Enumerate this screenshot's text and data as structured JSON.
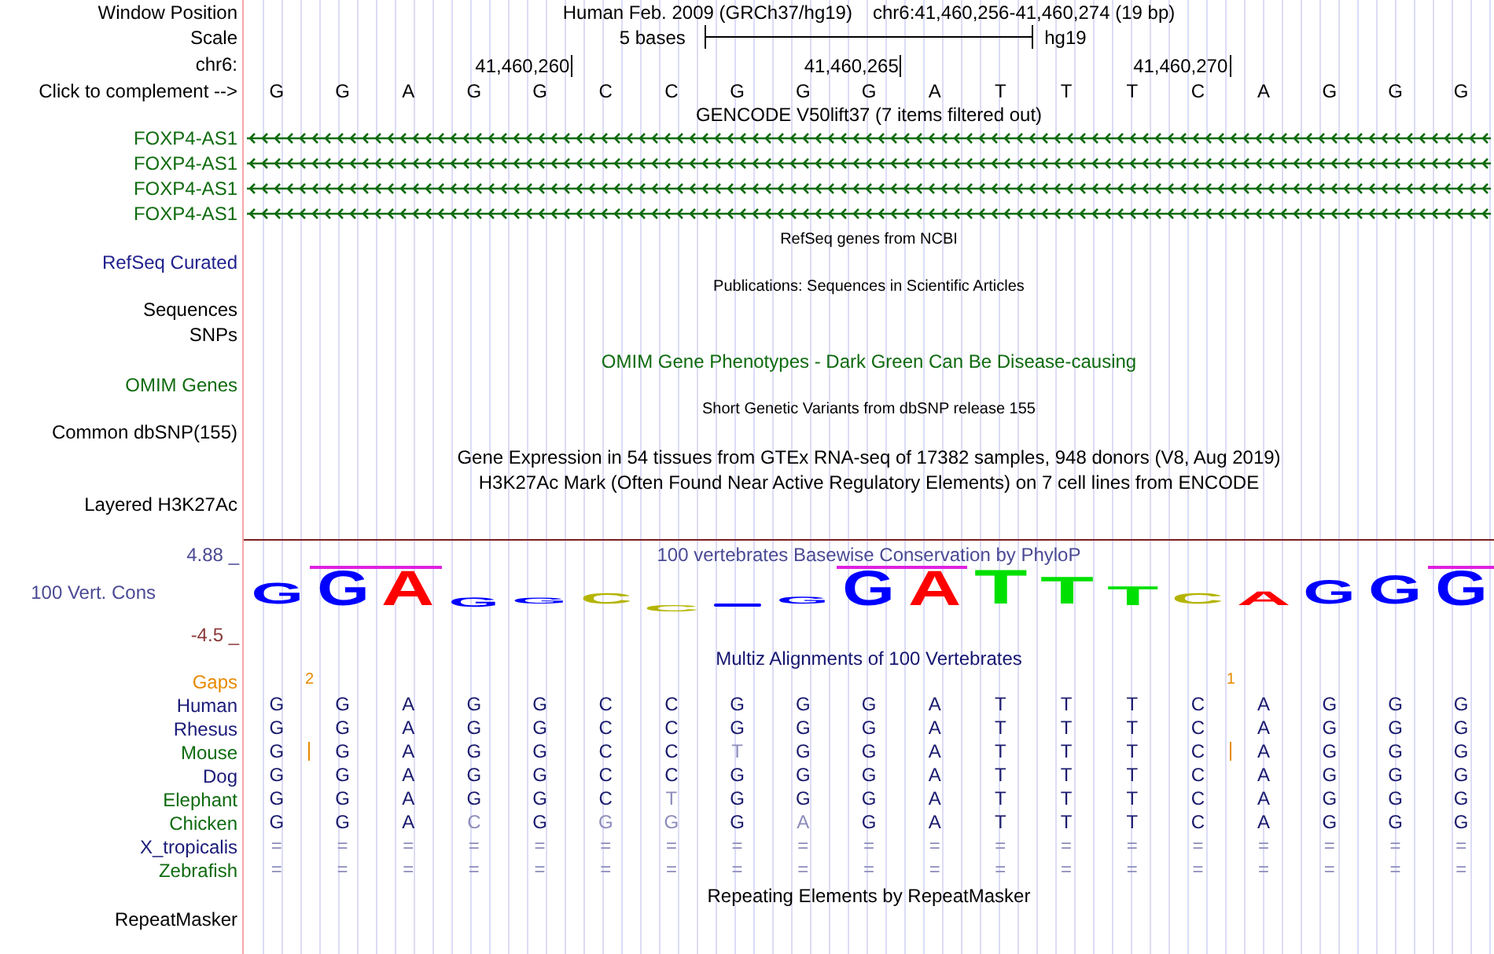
{
  "header": {
    "window_position": {
      "label": "Window Position",
      "assembly": "Human Feb. 2009 (GRCh37/hg19)",
      "range": "chr6:41,460,256-41,460,274 (19 bp)"
    },
    "scale": {
      "label": "Scale",
      "span": "5 bases",
      "assembly": "hg19"
    },
    "ruler": {
      "label": "chr6:",
      "ticks": [
        "41,460,260",
        "41,460,265",
        "41,460,270"
      ]
    },
    "sequence": {
      "label": "Click to complement -->",
      "bases": [
        "G",
        "G",
        "A",
        "G",
        "G",
        "C",
        "C",
        "G",
        "G",
        "G",
        "A",
        "T",
        "T",
        "T",
        "C",
        "A",
        "G",
        "G",
        "G"
      ]
    }
  },
  "tracks": [
    {
      "kind": "genes",
      "title": {
        "text": "GENCODE V50lift37 (7 items filtered out)",
        "color": "#000000"
      },
      "items": [
        {
          "label": "FOXP4-AS1",
          "color": "#0f6b0f"
        },
        {
          "label": "FOXP4-AS1",
          "color": "#0f6b0f"
        },
        {
          "label": "FOXP4-AS1",
          "color": "#0f6b0f"
        },
        {
          "label": "FOXP4-AS1",
          "color": "#0f6b0f"
        }
      ]
    },
    {
      "kind": "compact",
      "title": {
        "text": "RefSeq genes from NCBI",
        "color": "#000000"
      },
      "label": {
        "text": "RefSeq Curated",
        "color": "#1e1e8c"
      }
    },
    {
      "kind": "compact",
      "title": {
        "text": "Publications: Sequences in Scientific Articles",
        "color": "#000000"
      },
      "label": {
        "text": "Sequences",
        "color": "#000000"
      }
    },
    {
      "kind": "compact",
      "label": {
        "text": "SNPs",
        "color": "#000000"
      }
    },
    {
      "kind": "full",
      "title": {
        "text": "OMIM Gene Phenotypes - Dark Green Can Be Disease-causing",
        "color": "#0f6b0f"
      },
      "label": {
        "text": "OMIM Genes",
        "color": "#0f6b0f"
      }
    },
    {
      "kind": "compact",
      "title": {
        "text": "Short Genetic Variants from dbSNP release 155",
        "color": "#000000"
      },
      "label": {
        "text": "Common dbSNP(155)",
        "color": "#000000"
      }
    },
    {
      "kind": "full",
      "title": {
        "text": "Gene Expression in 54 tissues from GTEx RNA-seq of 17382 samples, 948 donors (V8, Aug 2019)",
        "color": "#000000"
      }
    },
    {
      "kind": "signal",
      "title": {
        "text": "H3K27Ac Mark (Often Found Near Active Regulatory Elements) on 7 cell lines from ENCODE",
        "color": "#000000"
      },
      "label": {
        "text": "Layered H3K27Ac",
        "color": "#000000"
      }
    },
    {
      "kind": "conservation",
      "title": {
        "text": "100 vertebrates Basewise Conservation by PhyloP",
        "color": "#4a4a94"
      },
      "label": {
        "text": "100 Vert. Cons",
        "color": "#4a4a94"
      },
      "axis_labels": [
        {
          "text": "4.88 _",
          "color": "#4a4a94"
        },
        {
          "text": "-4.5 _",
          "color": "#8b3a3a"
        }
      ],
      "logo": [
        {
          "base": "G",
          "color": "#0000ff",
          "clipped": false
        },
        {
          "base": "G",
          "color": "#0000ff",
          "clipped": true
        },
        {
          "base": "A",
          "color": "#ff0000",
          "clipped": true
        },
        {
          "base": "G",
          "color": "#0000ff",
          "clipped": false
        },
        {
          "base": "G",
          "color": "#0000ff",
          "clipped": false
        },
        {
          "base": "C",
          "color": "#b4b400",
          "clipped": false
        },
        {
          "base": "C",
          "color": "#b4b400",
          "clipped": false
        },
        {
          "color": "#0000ff",
          "clipped": false
        },
        {
          "base": "G",
          "color": "#0000ff",
          "clipped": false
        },
        {
          "base": "G",
          "color": "#0000ff",
          "clipped": true
        },
        {
          "base": "A",
          "color": "#ff0000",
          "clipped": true
        },
        {
          "base": "T",
          "color": "#00e000",
          "clipped": false
        },
        {
          "base": "T",
          "color": "#00e000",
          "clipped": false
        },
        {
          "base": "T",
          "color": "#00e000",
          "clipped": false
        },
        {
          "base": "C",
          "color": "#b4b400",
          "clipped": false
        },
        {
          "base": "A",
          "color": "#ff0000",
          "clipped": false
        },
        {
          "base": "G",
          "color": "#0000ff",
          "clipped": false
        },
        {
          "base": "G",
          "color": "#0000ff",
          "clipped": false
        },
        {
          "base": "G",
          "color": "#0000ff",
          "clipped": true
        }
      ]
    },
    {
      "kind": "alignment",
      "title": {
        "text": "Multiz Alignments of 100 Vertebrates",
        "color": "#141470"
      },
      "gaps": {
        "label": "Gaps",
        "columns": [
          {
            "insertion": false
          },
          {
            "insertion": true,
            "count": "2"
          },
          {
            "insertion": false
          },
          {
            "insertion": false
          },
          {
            "insertion": false
          },
          {
            "insertion": false
          },
          {
            "insertion": false
          },
          {
            "insertion": false
          },
          {
            "insertion": false
          },
          {
            "insertion": false
          },
          {
            "insertion": false
          },
          {
            "insertion": false
          },
          {
            "insertion": false
          },
          {
            "insertion": false
          },
          {
            "insertion": false
          },
          {
            "insertion": true,
            "count": "1"
          },
          {
            "insertion": false
          },
          {
            "insertion": false
          },
          {
            "insertion": false
          }
        ]
      },
      "species": [
        {
          "name": "Human",
          "color": "#1a1a78",
          "bases": [
            {
              "base": "G",
              "match": true
            },
            {
              "base": "G",
              "match": true
            },
            {
              "base": "A",
              "match": true
            },
            {
              "base": "G",
              "match": true
            },
            {
              "base": "G",
              "match": true
            },
            {
              "base": "C",
              "match": true
            },
            {
              "base": "C",
              "match": true
            },
            {
              "base": "G",
              "match": true
            },
            {
              "base": "G",
              "match": true
            },
            {
              "base": "G",
              "match": true
            },
            {
              "base": "A",
              "match": true
            },
            {
              "base": "T",
              "match": true
            },
            {
              "base": "T",
              "match": true
            },
            {
              "base": "T",
              "match": true
            },
            {
              "base": "C",
              "match": true
            },
            {
              "base": "A",
              "match": true
            },
            {
              "base": "G",
              "match": true
            },
            {
              "base": "G",
              "match": true
            },
            {
              "base": "G",
              "match": true
            }
          ]
        },
        {
          "name": "Rhesus",
          "color": "#1a1a78",
          "bases": [
            {
              "base": "G",
              "match": true
            },
            {
              "base": "G",
              "match": true
            },
            {
              "base": "A",
              "match": true
            },
            {
              "base": "G",
              "match": true
            },
            {
              "base": "G",
              "match": true
            },
            {
              "base": "C",
              "match": true
            },
            {
              "base": "C",
              "match": true
            },
            {
              "base": "G",
              "match": true
            },
            {
              "base": "G",
              "match": true
            },
            {
              "base": "G",
              "match": true
            },
            {
              "base": "A",
              "match": true
            },
            {
              "base": "T",
              "match": true
            },
            {
              "base": "T",
              "match": true
            },
            {
              "base": "T",
              "match": true
            },
            {
              "base": "C",
              "match": true
            },
            {
              "base": "A",
              "match": true
            },
            {
              "base": "G",
              "match": true
            },
            {
              "base": "G",
              "match": true
            },
            {
              "base": "G",
              "match": true
            }
          ]
        },
        {
          "name": "Mouse",
          "color": "#0f6b0f",
          "bases": [
            {
              "base": "G",
              "match": true,
              "insertion": false
            },
            {
              "base": "G",
              "match": true,
              "insertion": true
            },
            {
              "base": "A",
              "match": true,
              "insertion": false
            },
            {
              "base": "G",
              "match": true,
              "insertion": false
            },
            {
              "base": "G",
              "match": true,
              "insertion": false
            },
            {
              "base": "C",
              "match": true,
              "insertion": false
            },
            {
              "base": "C",
              "match": true,
              "insertion": false
            },
            {
              "base": "T",
              "match": false,
              "insertion": false
            },
            {
              "base": "G",
              "match": true,
              "insertion": false
            },
            {
              "base": "G",
              "match": true,
              "insertion": false
            },
            {
              "base": "A",
              "match": true,
              "insertion": false
            },
            {
              "base": "T",
              "match": true,
              "insertion": false
            },
            {
              "base": "T",
              "match": true,
              "insertion": false
            },
            {
              "base": "T",
              "match": true,
              "insertion": false
            },
            {
              "base": "C",
              "match": true,
              "insertion": false
            },
            {
              "base": "A",
              "match": true,
              "insertion": true
            },
            {
              "base": "G",
              "match": true,
              "insertion": false
            },
            {
              "base": "G",
              "match": true,
              "insertion": false
            },
            {
              "base": "G",
              "match": true,
              "insertion": false
            }
          ]
        },
        {
          "name": "Dog",
          "color": "#1a1a78",
          "bases": [
            {
              "base": "G",
              "match": true
            },
            {
              "base": "G",
              "match": true
            },
            {
              "base": "A",
              "match": true
            },
            {
              "base": "G",
              "match": true
            },
            {
              "base": "G",
              "match": true
            },
            {
              "base": "C",
              "match": true
            },
            {
              "base": "C",
              "match": true
            },
            {
              "base": "G",
              "match": true
            },
            {
              "base": "G",
              "match": true
            },
            {
              "base": "G",
              "match": true
            },
            {
              "base": "A",
              "match": true
            },
            {
              "base": "T",
              "match": true
            },
            {
              "base": "T",
              "match": true
            },
            {
              "base": "T",
              "match": true
            },
            {
              "base": "C",
              "match": true
            },
            {
              "base": "A",
              "match": true
            },
            {
              "base": "G",
              "match": true
            },
            {
              "base": "G",
              "match": true
            },
            {
              "base": "G",
              "match": true
            }
          ]
        },
        {
          "name": "Elephant",
          "color": "#0f6b0f",
          "bases": [
            {
              "base": "G",
              "match": true
            },
            {
              "base": "G",
              "match": true
            },
            {
              "base": "A",
              "match": true
            },
            {
              "base": "G",
              "match": true
            },
            {
              "base": "G",
              "match": true
            },
            {
              "base": "C",
              "match": true
            },
            {
              "base": "T",
              "match": false
            },
            {
              "base": "G",
              "match": true
            },
            {
              "base": "G",
              "match": true
            },
            {
              "base": "G",
              "match": true
            },
            {
              "base": "A",
              "match": true
            },
            {
              "base": "T",
              "match": true
            },
            {
              "base": "T",
              "match": true
            },
            {
              "base": "T",
              "match": true
            },
            {
              "base": "C",
              "match": true
            },
            {
              "base": "A",
              "match": true
            },
            {
              "base": "G",
              "match": true
            },
            {
              "base": "G",
              "match": true
            },
            {
              "base": "G",
              "match": true
            }
          ]
        },
        {
          "name": "Chicken",
          "color": "#0f6b0f",
          "bases": [
            {
              "base": "G",
              "match": true
            },
            {
              "base": "G",
              "match": true
            },
            {
              "base": "A",
              "match": true
            },
            {
              "base": "C",
              "match": false
            },
            {
              "base": "G",
              "match": true
            },
            {
              "base": "G",
              "match": false
            },
            {
              "base": "G",
              "match": false
            },
            {
              "base": "G",
              "match": true
            },
            {
              "base": "A",
              "match": false
            },
            {
              "base": "G",
              "match": true
            },
            {
              "base": "A",
              "match": true
            },
            {
              "base": "T",
              "match": true
            },
            {
              "base": "T",
              "match": true
            },
            {
              "base": "T",
              "match": true
            },
            {
              "base": "C",
              "match": true
            },
            {
              "base": "A",
              "match": true
            },
            {
              "base": "G",
              "match": true
            },
            {
              "base": "G",
              "match": true
            },
            {
              "base": "G",
              "match": true
            }
          ]
        },
        {
          "name": "X_tropicalis",
          "color": "#1a1a78",
          "bases": [
            {
              "base": "=",
              "match": false
            },
            {
              "base": "=",
              "match": false
            },
            {
              "base": "=",
              "match": false
            },
            {
              "base": "=",
              "match": false
            },
            {
              "base": "=",
              "match": false
            },
            {
              "base": "=",
              "match": false
            },
            {
              "base": "=",
              "match": false
            },
            {
              "base": "=",
              "match": false
            },
            {
              "base": "=",
              "match": false
            },
            {
              "base": "=",
              "match": false
            },
            {
              "base": "=",
              "match": false
            },
            {
              "base": "=",
              "match": false
            },
            {
              "base": "=",
              "match": false
            },
            {
              "base": "=",
              "match": false
            },
            {
              "base": "=",
              "match": false
            },
            {
              "base": "=",
              "match": false
            },
            {
              "base": "=",
              "match": false
            },
            {
              "base": "=",
              "match": false
            },
            {
              "base": "=",
              "match": false
            }
          ]
        },
        {
          "name": "Zebrafish",
          "color": "#0f6b0f",
          "bases": [
            {
              "base": "=",
              "match": false
            },
            {
              "base": "=",
              "match": false
            },
            {
              "base": "=",
              "match": false
            },
            {
              "base": "=",
              "match": false
            },
            {
              "base": "=",
              "match": false
            },
            {
              "base": "=",
              "match": false
            },
            {
              "base": "=",
              "match": false
            },
            {
              "base": "=",
              "match": false
            },
            {
              "base": "=",
              "match": false
            },
            {
              "base": "=",
              "match": false
            },
            {
              "base": "=",
              "match": false
            },
            {
              "base": "=",
              "match": false
            },
            {
              "base": "=",
              "match": false
            },
            {
              "base": "=",
              "match": false
            },
            {
              "base": "=",
              "match": false
            },
            {
              "base": "=",
              "match": false
            },
            {
              "base": "=",
              "match": false
            },
            {
              "base": "=",
              "match": false
            },
            {
              "base": "=",
              "match": false
            }
          ]
        }
      ]
    },
    {
      "kind": "full",
      "title": {
        "text": "Repeating Elements by RepeatMasker",
        "color": "#000000"
      },
      "label": {
        "text": "RepeatMasker",
        "color": "#000000"
      }
    }
  ]
}
